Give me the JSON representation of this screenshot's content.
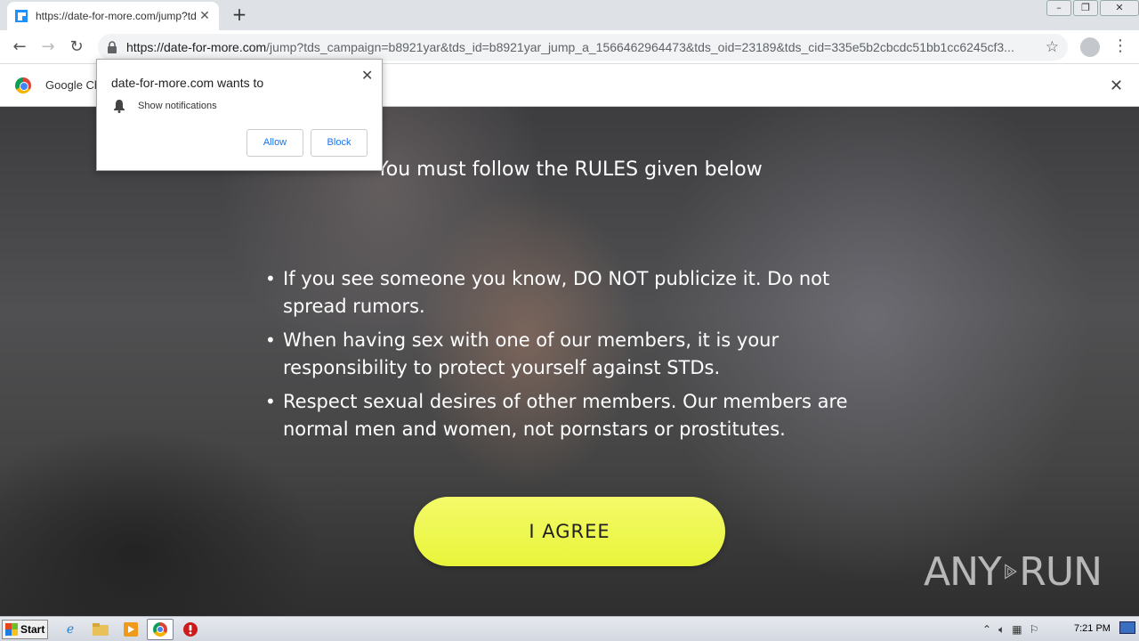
{
  "browser": {
    "tab_title": "https://date-for-more.com/jump?tds",
    "url_host": "https://date-for-more.com",
    "url_path": "/jump?tds_campaign=b8921yar&tds_id=b8921yar_jump_a_1566462964473&tds_oid=23189&tds_cid=335e5b2cbcdc51bb1cc6245cf3...",
    "infobar_text": "Google Ch"
  },
  "notification": {
    "title": "date-for-more.com wants to",
    "permission": "Show notifications",
    "allow_label": "Allow",
    "block_label": "Block"
  },
  "page": {
    "title": "You must follow the RULES given below",
    "rules": [
      "If you see someone you know, DO NOT publicize it. Do not spread rumors.",
      "When having sex with one of our members, it is your responsibility to protect yourself against STDs.",
      "Respect sexual desires of other members. Our members are normal men and women, not pornstars or prostitutes."
    ],
    "agree_label": "I AGREE",
    "watermark_left": "ANY",
    "watermark_right": "RUN"
  },
  "taskbar": {
    "start_label": "Start",
    "clock": "7:21 PM"
  },
  "colors": {
    "agree_button": "#eef54a",
    "link_blue": "#1a73e8"
  }
}
